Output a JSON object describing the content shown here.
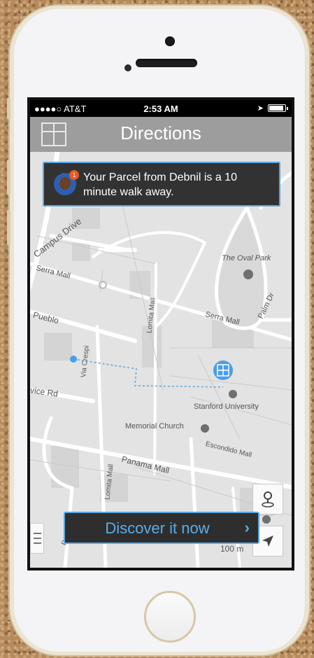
{
  "status_bar": {
    "carrier": "●●●●○ AT&T",
    "time": "2:53 AM",
    "battery_level": 0.9
  },
  "header": {
    "title": "Directions",
    "gift_icon": "gift-icon"
  },
  "notification": {
    "message": "Your Parcel from Debnil is a 10 minute walk away.",
    "badge": "1"
  },
  "map": {
    "labels": {
      "campus_drive": "Campus Drive",
      "serra_mall_left": "Serra Mall",
      "serra_mall_right": "Serra Mall",
      "oval_park": "The Oval Park",
      "palm_dr": "Palm Dr",
      "lomita_mall_top": "Lomita Mall",
      "pueblo": "Pueblo",
      "via_crespi": "Via Crespi",
      "vice_rd": "vice Rd",
      "stanford_university": "Stanford University",
      "memorial_church": "Memorial Church",
      "escondido_mall": "Escondido Mall",
      "panama_mall": "Panama Mall",
      "lomita_mall_bottom": "Lomita Mall",
      "bottom_left": "Roble"
    },
    "scale": "100 m"
  },
  "cta": {
    "label": "Discover it now",
    "chevron": "›"
  },
  "colors": {
    "accent": "#5aa7e0",
    "navbar": "#9d9d9d",
    "panel": "#323232"
  }
}
